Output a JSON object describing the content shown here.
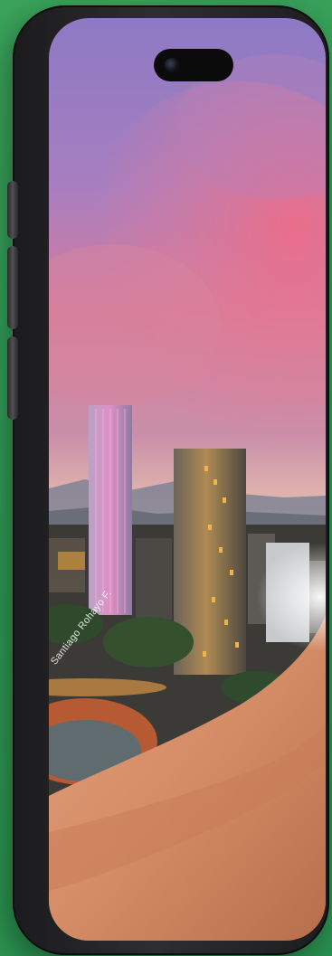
{
  "photo": {
    "watermark_text": "Santiago Rohayo F.",
    "alt": ""
  },
  "colors": {
    "background_green": "#2f9a55",
    "phone_frame": "#1f1f21",
    "sky_pink": "#e0708a",
    "sky_purple": "#7c72b8",
    "city_gold": "#e2a440",
    "skin_tone": "#d99873"
  },
  "icons": {
    "front_camera": "camera-icon"
  }
}
